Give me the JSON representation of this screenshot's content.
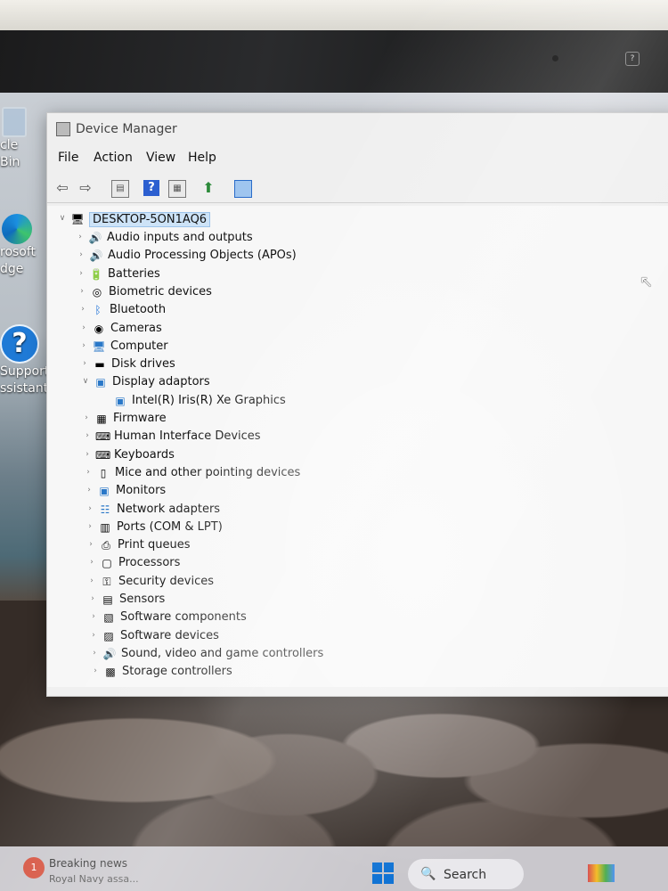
{
  "desktop": {
    "recycle_bin_label": "cle Bin",
    "edge_label_1": "rosoft",
    "edge_label_2": "dge",
    "help_label_1": "Support",
    "help_label_2": "ssistant"
  },
  "window": {
    "title": "Device Manager",
    "menu": [
      "File",
      "Action",
      "View",
      "Help"
    ],
    "toolbar_icons": [
      "back-arrow-icon",
      "forward-arrow-icon",
      "properties-icon",
      "help-icon",
      "view-icon",
      "update-driver-icon",
      "monitor-icon"
    ],
    "root": "DESKTOP-5ON1AQ6",
    "items": [
      {
        "label": "Audio inputs and outputs",
        "icon": "speaker-icon",
        "expanded": false
      },
      {
        "label": "Audio Processing Objects (APOs)",
        "icon": "speaker-icon",
        "expanded": false
      },
      {
        "label": "Batteries",
        "icon": "battery-icon",
        "expanded": false
      },
      {
        "label": "Biometric devices",
        "icon": "fingerprint-icon",
        "expanded": false
      },
      {
        "label": "Bluetooth",
        "icon": "bluetooth-icon",
        "expanded": false
      },
      {
        "label": "Cameras",
        "icon": "camera-icon",
        "expanded": false
      },
      {
        "label": "Computer",
        "icon": "computer-icon",
        "expanded": false
      },
      {
        "label": "Disk drives",
        "icon": "disk-icon",
        "expanded": false
      },
      {
        "label": "Display adaptors",
        "icon": "display-icon",
        "expanded": true
      },
      {
        "label": "Intel(R) Iris(R) Xe Graphics",
        "icon": "display-icon",
        "child": true
      },
      {
        "label": "Firmware",
        "icon": "chip-icon",
        "expanded": false
      },
      {
        "label": "Human Interface Devices",
        "icon": "hid-icon",
        "expanded": false
      },
      {
        "label": "Keyboards",
        "icon": "keyboard-icon",
        "expanded": false
      },
      {
        "label": "Mice and other pointing devices",
        "icon": "mouse-icon",
        "expanded": false
      },
      {
        "label": "Monitors",
        "icon": "monitor-icon",
        "expanded": false
      },
      {
        "label": "Network adapters",
        "icon": "network-icon",
        "expanded": false
      },
      {
        "label": "Ports (COM & LPT)",
        "icon": "port-icon",
        "expanded": false
      },
      {
        "label": "Print queues",
        "icon": "printer-icon",
        "expanded": false
      },
      {
        "label": "Processors",
        "icon": "processor-icon",
        "expanded": false
      },
      {
        "label": "Security devices",
        "icon": "security-icon",
        "expanded": false
      },
      {
        "label": "Sensors",
        "icon": "sensor-icon",
        "expanded": false
      },
      {
        "label": "Software components",
        "icon": "software-component-icon",
        "expanded": false
      },
      {
        "label": "Software devices",
        "icon": "software-device-icon",
        "expanded": false
      },
      {
        "label": "Sound, video and game controllers",
        "icon": "speaker-icon",
        "expanded": false
      },
      {
        "label": "Storage controllers",
        "icon": "storage-icon",
        "expanded": false
      }
    ]
  },
  "taskbar": {
    "news_title": "Breaking news",
    "news_subtitle": "Royal Navy assa...",
    "search_label": "Search"
  },
  "colors": {
    "selection": "#cde3f7",
    "accent": "#1173d4"
  }
}
